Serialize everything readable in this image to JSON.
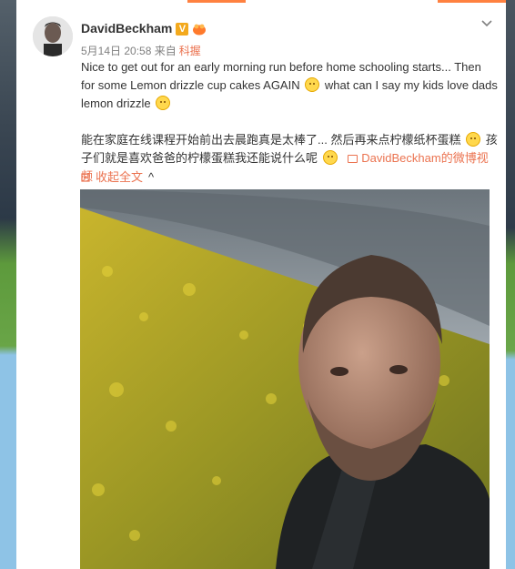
{
  "post": {
    "author": "DavidBeckham",
    "verified_badge": "V",
    "timestamp": "5月14日 20:58",
    "source_prefix": "来自",
    "source": "科握",
    "text_en_1": "Nice to get out for an early morning run before home schooling starts... Then for some Lemon drizzle cup cakes AGAIN",
    "text_en_2": "what can I say my kids love dads lemon drizzle",
    "text_zh_1": "能在家庭在线课程开始前出去晨跑真是太棒了... 然后再来点柠檬纸杯蛋糕",
    "text_zh_2": "孩子们就是喜欢爸爸的柠檬蛋糕我还能说什么呢",
    "video_link": "DavidBeckham的微博视频",
    "collapse_label": "收起全文",
    "collapse_chevron": "^"
  },
  "icons": {
    "dropdown": "chevron-down-icon",
    "smile": "smile-emoji-icon",
    "thinking": "thinking-emoji-icon",
    "video": "video-icon",
    "collapse": "collapse-icon"
  },
  "colors": {
    "link": "#eb7350",
    "accent_tab": "#ff8140",
    "verified": "#f3a91d"
  }
}
